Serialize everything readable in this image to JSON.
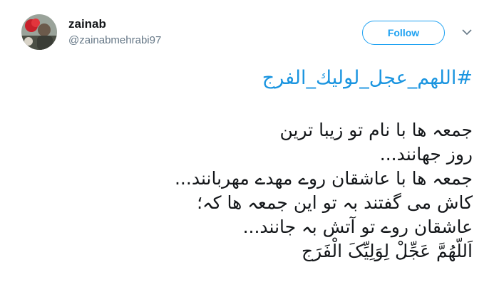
{
  "tweet": {
    "author_name": "zainab",
    "author_handle": "@zainabmehrabi97",
    "follow_label": "Follow",
    "hashtag": "#اللهم_عجل_لولیك_الفرج",
    "lines": [
      "جمعہ ها با نام تو زیبا ترین",
      "روز جهانند...",
      "جمعہ ها با عاشقان روے مهدے مهربانند...",
      "کاش مى گفتند بہ تو این جمعہ ها کہ؛",
      "عاشقان روے تو آتش بہ جانند...",
      "اَللّهُمَّ عَجِّلْ لِوَلِیِّکَ الْفَرَج"
    ]
  },
  "colors": {
    "accent": "#1da1f2",
    "hashtag": "#1b95e0",
    "handle": "#657786",
    "text": "#14171a"
  },
  "icons": {
    "avatar": "avatar-photo",
    "menu": "chevron-down-icon"
  }
}
